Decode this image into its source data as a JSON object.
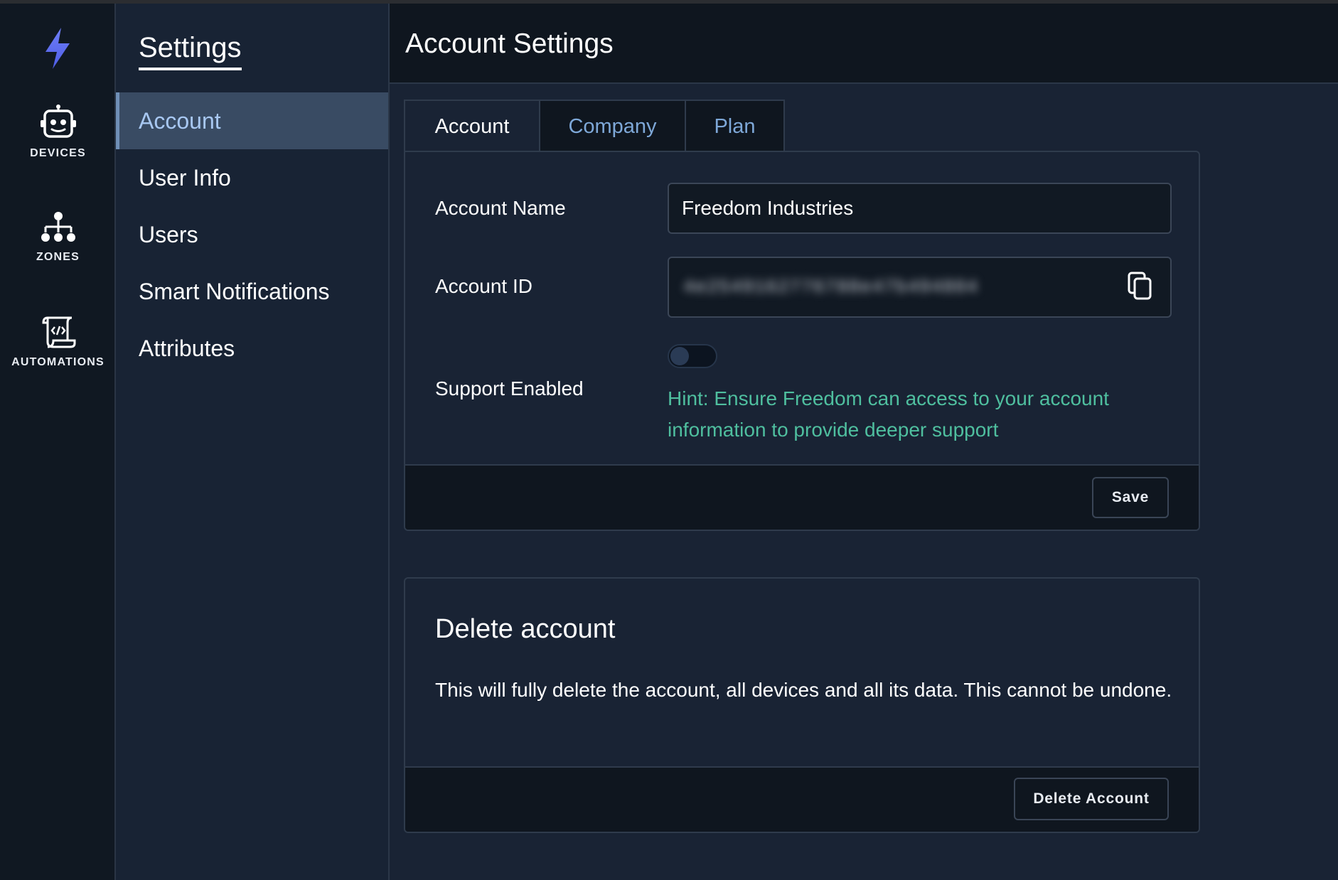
{
  "rail": {
    "items": [
      {
        "label": "DEVICES",
        "icon": "robot-icon"
      },
      {
        "label": "ZONES",
        "icon": "hierarchy-icon"
      },
      {
        "label": "AUTOMATIONS",
        "icon": "script-code-icon"
      }
    ],
    "logo_color": "#5b6cf0"
  },
  "sidebar": {
    "title": "Settings",
    "items": [
      {
        "label": "Account",
        "active": true
      },
      {
        "label": "User Info"
      },
      {
        "label": "Users"
      },
      {
        "label": "Smart Notifications"
      },
      {
        "label": "Attributes"
      }
    ]
  },
  "header": {
    "title": "Account Settings"
  },
  "tabs": [
    {
      "label": "Account",
      "active": true
    },
    {
      "label": "Company"
    },
    {
      "label": "Plan"
    }
  ],
  "account_form": {
    "name_label": "Account Name",
    "name_value": "Freedom Industries",
    "id_label": "Account ID",
    "id_value": "4e2549162776788e47b494804",
    "support_label": "Support Enabled",
    "support_enabled": false,
    "hint": "Hint: Ensure Freedom can access to your account information to provide deeper support",
    "save_label": "Save"
  },
  "delete_section": {
    "title": "Delete account",
    "description": "This will fully delete the account, all devices and all its data. This cannot be undone.",
    "button_label": "Delete Account"
  },
  "colors": {
    "hint": "#4fbf9f",
    "active_tab_text": "#ffffff",
    "inactive_tab_text": "#7ea8d8",
    "active_sidebar_bg": "#394b63"
  }
}
